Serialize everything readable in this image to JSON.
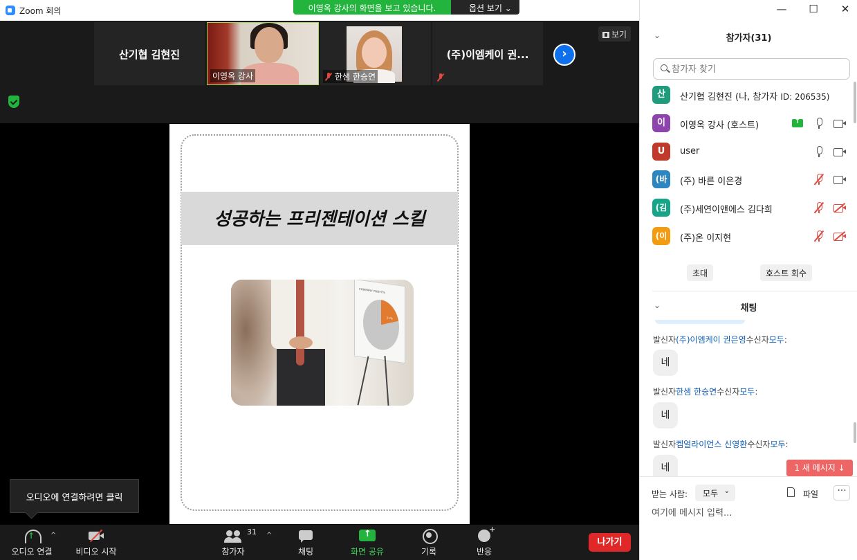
{
  "window": {
    "title": "Zoom 회의",
    "minimize": "—",
    "maximize": "☐",
    "close": "✕"
  },
  "share_banner": {
    "text": "이영옥 강사의 화면을 보고 있습니다.",
    "options": "옵션 보기 ⌄"
  },
  "filmstrip": {
    "tiles": [
      {
        "name": "산기협 김현진",
        "video": false
      },
      {
        "name": "이영옥 강사",
        "video": true,
        "active": true
      },
      {
        "name": "한샘 한승연",
        "video": true,
        "muted": true
      },
      {
        "name": "(주)이엠케이 권...",
        "video": false,
        "muted": true
      }
    ],
    "next": "›",
    "view_label": "보기"
  },
  "slide": {
    "title": "성공하는 프리젠테이션 스킬",
    "photo_chart_title": "COMPANY PROFITS",
    "photo_chart_value": "21%"
  },
  "tooltip": "오디오에 연결하려면 클릭",
  "toolbar": {
    "audio": "오디오 연결",
    "video": "비디오 시작",
    "participants": "참가자",
    "participants_count": "31",
    "chat": "채팅",
    "share": "화면 공유",
    "record": "기록",
    "reactions": "반응",
    "leave": "나가기",
    "caret": "^"
  },
  "participants_panel": {
    "title": "참가자(31)",
    "search_placeholder": "참가자 찾기",
    "list": [
      {
        "initial": "산",
        "color": "#1f9c7c",
        "name": "산기협 김현진 (나, 참가자 ",
        "id": "ID: 206535)"
      },
      {
        "initial": "이",
        "color": "#8e44ad",
        "name": "이영옥 강사 (호스트)",
        "sharing": true,
        "mic": "on",
        "cam": "on"
      },
      {
        "initial": "U",
        "color": "#c0392b",
        "name": "user",
        "mic": "on",
        "cam": "on"
      },
      {
        "initial": "(바",
        "color": "#2e86c1",
        "name": "(주) 바른 이은경",
        "mic": "muted",
        "cam": "on"
      },
      {
        "initial": "(김",
        "color": "#17a589",
        "name": "(주)세연이앤에스 김다희",
        "mic": "muted",
        "cam": "muted"
      },
      {
        "initial": "(이",
        "color": "#f39c12",
        "name": "(주)온 이지현",
        "mic": "muted",
        "cam": "muted"
      }
    ],
    "invite": "초대",
    "reclaim_host": "호스트 회수"
  },
  "chat_panel": {
    "title": "채팅",
    "messages": [
      {
        "prefix": "발신자",
        "sender": "(주)이엠케이 권은영",
        "mid": "수신자",
        "recipient": "모두",
        "suffix": ":",
        "text": "네"
      },
      {
        "prefix": "발신자",
        "sender": "한샘 한승연",
        "mid": "수신자",
        "recipient": "모두",
        "suffix": ":",
        "text": "네"
      },
      {
        "prefix": "발신자",
        "sender": "켐얼라이언스 신영환",
        "mid": "수신자",
        "recipient": "모두",
        "suffix": ":",
        "text": "네"
      }
    ],
    "new_message": "1 새 메시지 ↓",
    "to_label": "받는 사람:",
    "to_value": "모두",
    "file_label": "파일",
    "more": "···",
    "input_placeholder": "여기에 메시지 입력..."
  }
}
